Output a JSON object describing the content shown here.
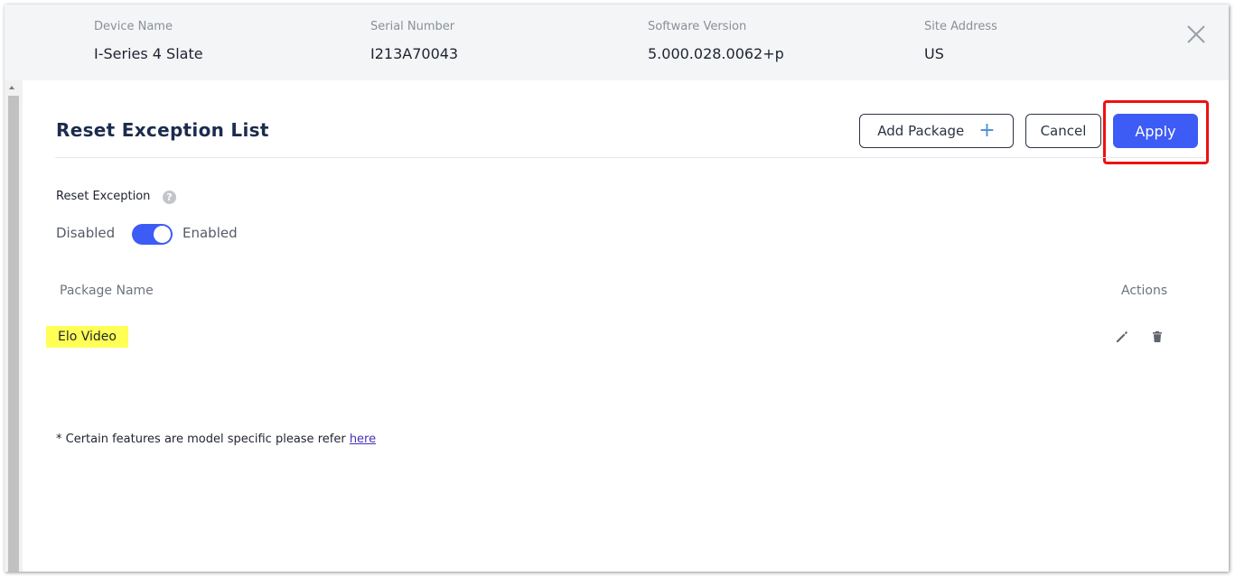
{
  "device": {
    "fields": [
      {
        "label": "Device Name",
        "value": "I-Series 4 Slate"
      },
      {
        "label": "Serial Number",
        "value": "I213A70043"
      },
      {
        "label": "Software Version",
        "value": "5.000.028.0062+p"
      },
      {
        "label": "Site Address",
        "value": "US"
      }
    ]
  },
  "page": {
    "title": "Reset Exception List"
  },
  "toolbar": {
    "add_package_label": "Add Package",
    "add_icon": "+",
    "cancel_label": "Cancel",
    "apply_label": "Apply"
  },
  "reset_exception": {
    "label": "Reset Exception",
    "help_icon": "?",
    "off_label": "Disabled",
    "on_label": "Enabled",
    "enabled": true
  },
  "table": {
    "columns": {
      "package_name": "Package Name",
      "actions": "Actions"
    },
    "rows": [
      {
        "package_name": "Elo Video",
        "actions": [
          "edit-icon",
          "delete-icon"
        ]
      }
    ]
  },
  "footnote": {
    "text": "* Certain features are model specific please refer",
    "link_text": "here"
  },
  "colors": {
    "primary": "#3d5bf5",
    "header_bg": "#f4f5f7",
    "title": "#1c2c4e",
    "highlight_annotation": "#ee1111",
    "row_highlight": "#ffff55"
  }
}
